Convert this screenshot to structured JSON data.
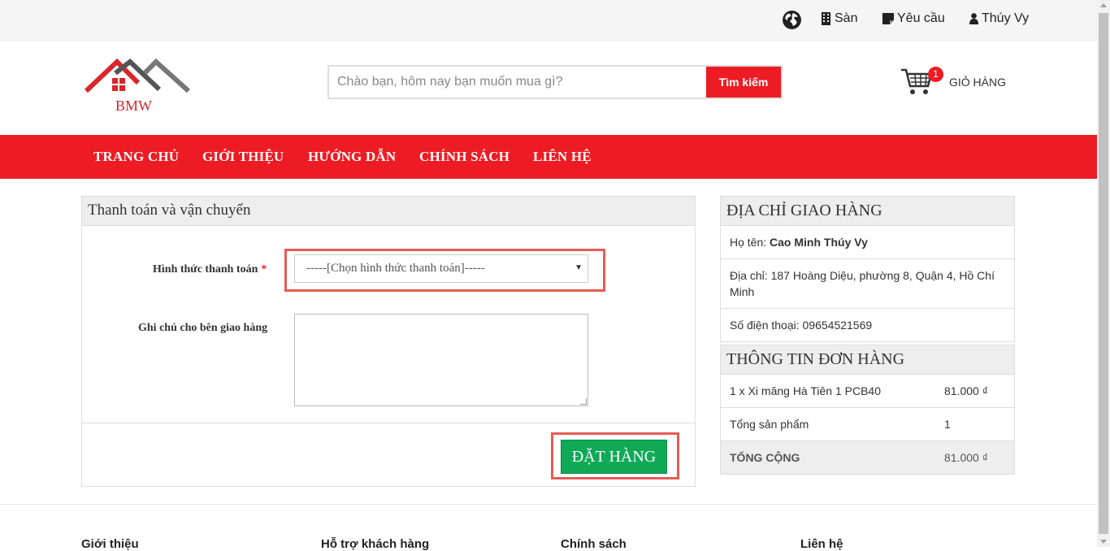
{
  "topbar": {
    "links": [
      {
        "label": "Sàn",
        "icon": "building-icon"
      },
      {
        "label": "Yêu cầu",
        "icon": "document-icon"
      },
      {
        "label": "Thúy Vy",
        "icon": "user-icon"
      }
    ]
  },
  "header": {
    "logo_text": "BMW",
    "search_placeholder": "Chào bạn, hôm nay bạn muốn mua gì?",
    "search_button": "Tìm kiếm",
    "cart_count": "1",
    "cart_label": "GIỎ HÀNG"
  },
  "nav": {
    "items": [
      "TRANG CHỦ",
      "GIỚI THIỆU",
      "HƯỚNG DẪN",
      "CHÍNH SÁCH",
      "LIÊN HỆ"
    ]
  },
  "payment": {
    "title": "Thanh toán và vận chuyển",
    "method_label": "Hình thức thanh toán",
    "required_mark": "*",
    "method_selected": "-----[Chọn hình thức thanh toán]-----",
    "note_label": "Ghi chú cho bên giao hàng",
    "note_value": "",
    "order_button": "ĐẶT HÀNG"
  },
  "address": {
    "title": "ĐỊA CHỈ GIAO HÀNG",
    "name_label": "Họ tên: ",
    "name": "Cao Minh Thúy Vy",
    "address": "Địa chỉ: 187 Hoàng Diệu, phường 8, Quận 4, Hồ Chí Minh",
    "phone": "Số điện thoại: 09654521569"
  },
  "order_info": {
    "title": "THÔNG TIN ĐƠN HÀNG",
    "rows": [
      {
        "label": "1 x Xi măng Hà Tiên 1 PCB40",
        "value": "81.000 ₫"
      },
      {
        "label": "Tổng sản phẩm",
        "value": "1"
      },
      {
        "label": "TỔNG CỘNG",
        "value": "81.000 ₫"
      }
    ]
  },
  "footer": {
    "headings": [
      "Giới thiệu",
      "Hỗ trợ khách hàng",
      "Chính sách",
      "Liên hệ"
    ]
  },
  "colors": {
    "brand_red": "#ed1c24",
    "order_green": "#0fa957",
    "highlight": "#e55c56"
  }
}
